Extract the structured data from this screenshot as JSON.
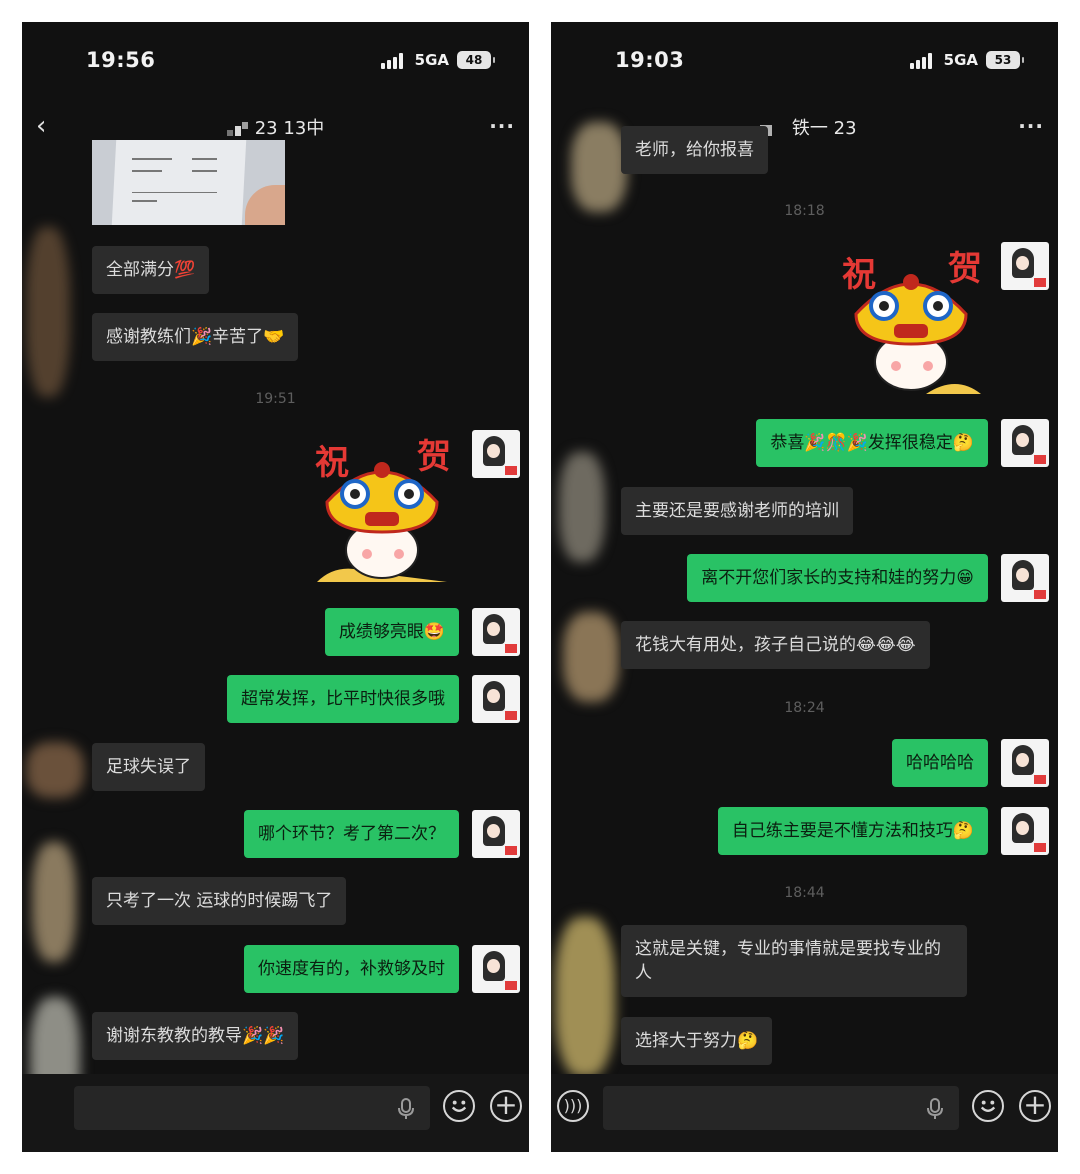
{
  "left": {
    "status": {
      "time": "19:56",
      "network": "5GA",
      "battery": "48"
    },
    "nav": {
      "title": "23 13中",
      "more": "···",
      "back": "‹"
    },
    "messages": {
      "m1": "全部满分💯",
      "m2": "感谢教练们🎉辛苦了🤝",
      "t1": "19:51",
      "m3": "成绩够亮眼🤩",
      "m4": "超常发挥，比平时快很多哦",
      "m5": "足球失误了",
      "m6": "哪个环节？考了第二次？",
      "m7": "只考了一次 运球的时候踢飞了",
      "m8": "你速度有的，补救够及时",
      "m9": "谢谢东教教的教导🎉🎉"
    },
    "sticker": {
      "left_char": "祝",
      "right_char": "贺"
    }
  },
  "right": {
    "status": {
      "time": "19:03",
      "network": "5GA",
      "battery": "53"
    },
    "nav": {
      "title": "铁一 23",
      "more": "···"
    },
    "messages": {
      "m1": "老师，给你报喜",
      "t1": "18:18",
      "m2": "恭喜🎉🎊🎉发挥很稳定🤔",
      "m3": "主要还是要感谢老师的培训",
      "m4": "离不开您们家长的支持和娃的努力😁",
      "m5": "花钱大有用处，孩子自己说的😂😂😂",
      "t2": "18:24",
      "m6": "哈哈哈哈",
      "m7": "自己练主要是不懂方法和技巧🤔",
      "t3": "18:44",
      "m8": "这就是关键，专业的事情就是要找专业的人",
      "m9": "选择大于努力🤔"
    },
    "sticker": {
      "left_char": "祝",
      "right_char": "贺"
    }
  },
  "icons": {
    "mic": "mic-icon",
    "emoji": "emoji-icon",
    "plus": "plus-icon",
    "voice": "voice-icon",
    "signal": "signal-icon",
    "battery": "battery-icon"
  },
  "colors": {
    "background": "#111111",
    "bubble_in": "#2c2c2c",
    "bubble_out": "#29c265",
    "timestamp": "#5e5e5e"
  }
}
